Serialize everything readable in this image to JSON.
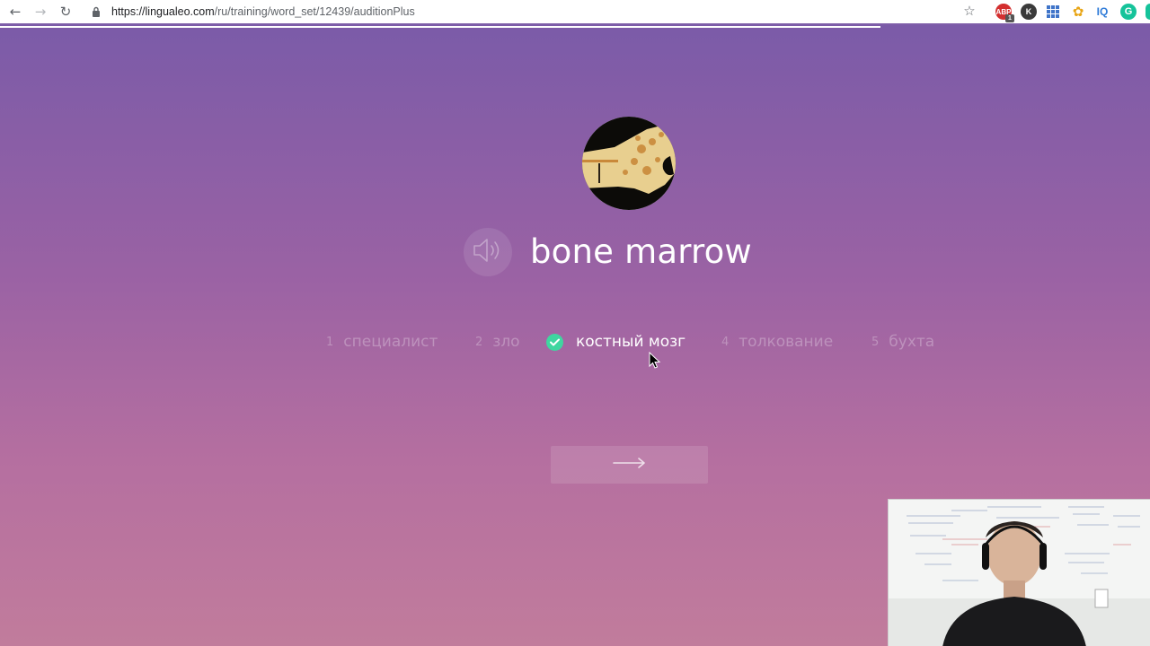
{
  "browser": {
    "url_host": "https://lingualeo.com",
    "url_path": "/ru/training/word_set/12439/auditionPlus",
    "extensions": [
      {
        "name": "abp-icon",
        "label": "ABP",
        "badge": "1"
      },
      {
        "name": "k-icon",
        "label": "K"
      },
      {
        "name": "grid-icon"
      },
      {
        "name": "puzzle-icon"
      },
      {
        "name": "iq-icon",
        "label": "IQ"
      },
      {
        "name": "grammarly-icon",
        "label": "G"
      }
    ]
  },
  "training": {
    "word": "bone marrow",
    "answers": [
      {
        "num": "1",
        "text": "специалист",
        "state": "dim"
      },
      {
        "num": "2",
        "text": "зло",
        "state": "dim"
      },
      {
        "num": "3",
        "text": "костный мозг",
        "state": "correct"
      },
      {
        "num": "4",
        "text": "толкование",
        "state": "dim"
      },
      {
        "num": "5",
        "text": "бухта",
        "state": "dim"
      }
    ]
  },
  "colors": {
    "bg_top": "#7b5ba8",
    "bg_bottom": "#c17c9c",
    "check": "#3fd6a0"
  }
}
